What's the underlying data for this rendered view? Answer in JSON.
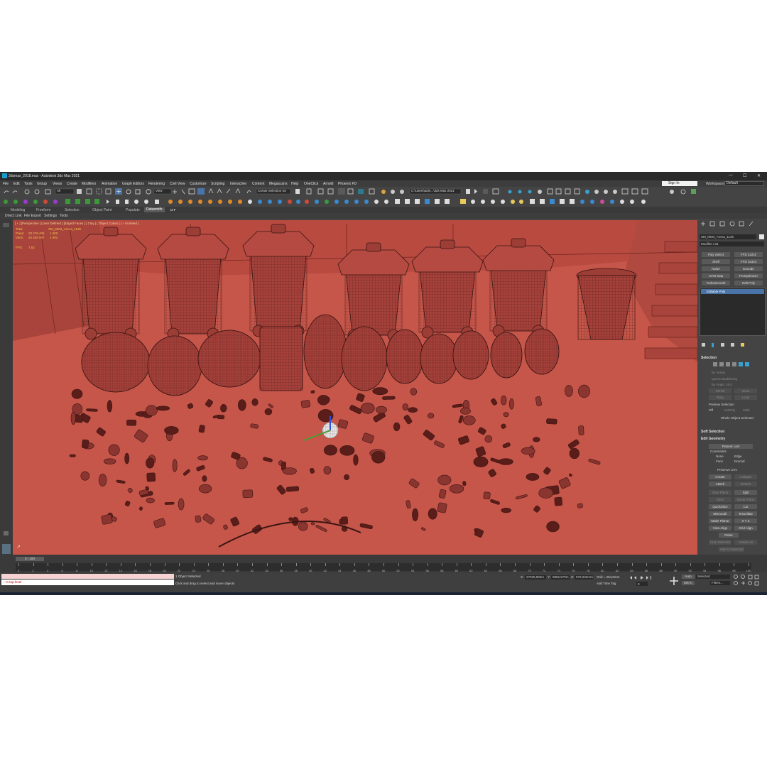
{
  "window": {
    "title": "3dsmax_2018.max - Autodesk 3ds Max 2021",
    "controls": [
      "—",
      "☐",
      "✕"
    ]
  },
  "menu": [
    "File",
    "Edit",
    "Tools",
    "Group",
    "Views",
    "Create",
    "Modifiers",
    "Animation",
    "Graph Editors",
    "Rendering",
    "Civil View",
    "Customize",
    "Scripting",
    "Interactive",
    "Content",
    "Megascans",
    "Help",
    "OneClick",
    "Arnold",
    "Phoenix FD"
  ],
  "signin": "Sign In",
  "workspaces": {
    "label": "Workspaces:",
    "value": "Default"
  },
  "toolbar": {
    "filter": "All",
    "view": "View",
    "selection_set": "Create Selection Se",
    "path": "C:\\Users\\adm...\\3ds Max 2021"
  },
  "ribbon_tabs": [
    "Modeling",
    "Freeform",
    "Selection",
    "Object Paint",
    "Populate",
    "Datasmith"
  ],
  "ribbon_active": "Datasmith",
  "subbar": [
    "Direct Link",
    "File Export",
    "Settings",
    "Tools"
  ],
  "viewport": {
    "label": "[ + ] [Perspective ] [User Defined ] [Edged Faces ] [ Clay ] [ Object Colors ] [ + Enabled ]",
    "stats": {
      "total_label": "Total",
      "object_name": "SM_MM4_Arena_1135",
      "polys_label": "Polys:",
      "polys_total": "23 479 426",
      "polys_sel": "1 600",
      "verts_label": "Verts:",
      "verts_total": "25 539 087",
      "verts_sel": "1 902",
      "fps_label": "FPS:",
      "fps": "7,52"
    }
  },
  "command_panel": {
    "object_name": "SM_MM4_Arena_1135",
    "modifier_list": "Modifier List",
    "buttons": [
      [
        "Poly Select",
        "FFD 2x2x2"
      ],
      [
        "Shell",
        "FFD 3x3x3"
      ],
      [
        "Noise",
        "Extrude"
      ],
      [
        "UVW Map",
        "ProOptimizer"
      ],
      [
        "TurboSmooth",
        "Edit Poly"
      ]
    ],
    "stack_item": "Editable Poly",
    "selection_head": "Selection",
    "selection_opts": [
      "By Vertex",
      "Ignore Backfacing",
      "By Angle:  45,0"
    ],
    "selection_btns": [
      [
        "Shrink",
        "Grow"
      ],
      [
        "Ring",
        "Loop"
      ]
    ],
    "preview_label": "Preview Selection",
    "preview_opts": [
      "Off",
      "SubObj",
      "Multi"
    ],
    "whole_selected": "Whole Object Selected",
    "soft_head": "Soft Selection",
    "edit_geo_head": "Edit Geometry",
    "repeat_last": "Repeat Last",
    "constraints_label": "Constraints",
    "constraints": [
      "None",
      "Edge",
      "Face",
      "Normal"
    ],
    "preserve_uvs": "Preserve UVs",
    "geo_btns": [
      [
        "Create",
        "Collapse"
      ],
      [
        "Attach",
        "Detach"
      ],
      [
        "Slice Plane",
        "Split"
      ],
      [
        "Slice",
        "Reset Plane"
      ],
      [
        "QuickSlice",
        "Cut"
      ],
      [
        "MSmooth",
        "Tessellate"
      ],
      [
        "Make Planar",
        "X  Y  Z"
      ],
      [
        "View Align",
        "Grid Align"
      ],
      [
        "Relax",
        ""
      ],
      [
        "Hide Selected",
        "Unhide All"
      ],
      [
        "Hide Unselected",
        ""
      ]
    ]
  },
  "timeline": {
    "slider": "0 / 100",
    "ticks": [
      "0",
      "2",
      "4",
      "6",
      "8",
      "10",
      "12",
      "14",
      "16",
      "18",
      "20",
      "22",
      "24",
      "26",
      "28",
      "30",
      "32",
      "34",
      "36",
      "38",
      "40",
      "42",
      "44",
      "46",
      "48",
      "50",
      "52",
      "54",
      "56",
      "58",
      "60",
      "62",
      "64",
      "66",
      "68",
      "70",
      "72",
      "74",
      "76",
      "78",
      "80",
      "82",
      "84",
      "86",
      "88",
      "90",
      "92",
      "94",
      "96",
      "98",
      "100"
    ]
  },
  "status": {
    "script_line": "-- In top-level",
    "selected": "1 Object Selected",
    "hint": "Click and drag to select and move objects",
    "x_label": "X:",
    "x_val": "27035,993m",
    "y_label": "Y:",
    "y_val": "9882,579m",
    "z_label": "Z:",
    "z_val": "575,032mm",
    "grid": "Grid = 254,0mm",
    "add_time_tag": "Add Time Tag",
    "auto": "Auto",
    "setk": "Set K.",
    "selected_drop": "Selected",
    "filters": "Filters...",
    "frame": "0"
  },
  "colors": {
    "viewport_bg": "#8e3a33",
    "mesh": "#9b3d36",
    "accent": "#4a74a8"
  }
}
